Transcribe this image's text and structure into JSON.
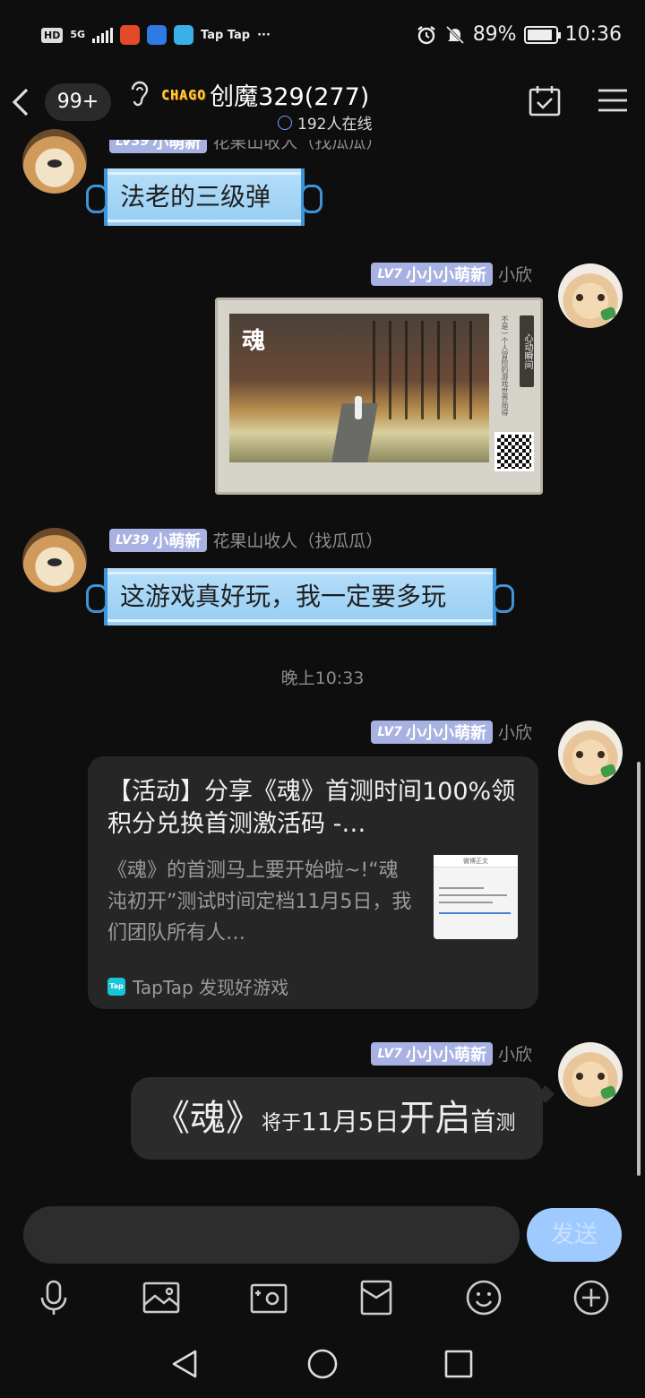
{
  "status_bar": {
    "hd": "HD",
    "net": "5G",
    "apps_text": "Tap Tap",
    "more": "···",
    "battery": "89%",
    "time": "10:36"
  },
  "header": {
    "unread_badge": "99+",
    "title_logo": "CHAGO",
    "title": "创魔329(277)",
    "online": "192人在线"
  },
  "messages": {
    "m1": {
      "level": "LV39",
      "tag": "小萌新",
      "name": "花果山收人（找瓜瓜）",
      "text": "法老的三级弹"
    },
    "m2": {
      "level": "LV7",
      "tag": "小小小萌新",
      "name": "小欣",
      "image": {
        "logo_glyph": "魂",
        "side_text": "不是一个人冒险的游戏世界局得",
        "side_tag": "心动瞬间"
      }
    },
    "m3": {
      "level": "LV39",
      "tag": "小萌新",
      "name": "花果山收人（找瓜瓜）",
      "text": "这游戏真好玩，我一定要多玩"
    },
    "time_divider": "晚上10:33",
    "m4": {
      "level": "LV7",
      "tag": "小小小萌新",
      "name": "小欣",
      "card": {
        "title": "【活动】分享《魂》首测时间100%领积分兑换首测激活码 -…",
        "desc": "《魂》的首测马上要开始啦~!“魂沌初开”测试时间定档11月5日，我们团队所有人…",
        "thumb_top": "微博正文",
        "source_logo": "Tap",
        "source": "TapTap 发现好游戏"
      }
    },
    "m5": {
      "level": "LV7",
      "tag": "小小小萌新",
      "name": "小欣",
      "text_parts": [
        "《魂》",
        "将于",
        "11月5日",
        "开启",
        "首",
        "测"
      ]
    }
  },
  "input": {
    "placeholder": "",
    "send_label": "发送"
  },
  "colors": {
    "background": "#0e0e0e",
    "level_badge": "#a7b1e2",
    "scroll_bubble": "#b7dffa",
    "send_button": "#9fcaff"
  }
}
